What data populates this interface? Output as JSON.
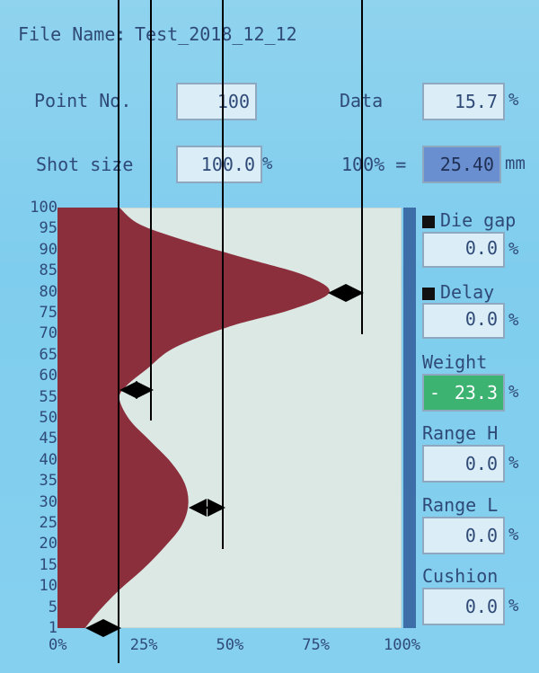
{
  "file_name_label": "File Name:",
  "file_name_value": "Test_2018_12_12",
  "point_no_label": "Point No.",
  "point_no_value": "100",
  "data_label": "Data",
  "data_value": "15.7",
  "data_unit": "%",
  "shot_size_label": "Shot size",
  "shot_size_value": "100.0",
  "shot_size_unit": "%",
  "hundred_pct_label": "100% =",
  "hundred_pct_value": "25.40",
  "hundred_pct_unit": "mm",
  "right_panel": {
    "die_gap": {
      "label": "Die gap",
      "value": "0.0",
      "unit": "%"
    },
    "delay": {
      "label": "Delay",
      "value": "0.0",
      "unit": "%"
    },
    "weight": {
      "label": "Weight",
      "sign": "-",
      "value": "23.3",
      "unit": "%"
    },
    "range_h": {
      "label": "Range H",
      "value": "0.0",
      "unit": "%"
    },
    "range_l": {
      "label": "Range L",
      "value": "0.0",
      "unit": "%"
    },
    "cushion": {
      "label": "Cushion",
      "value": "0.0",
      "unit": "%"
    }
  },
  "chart_data": {
    "type": "area",
    "y_ticks": [
      "100",
      "95",
      "90",
      "85",
      "80",
      "75",
      "70",
      "65",
      "60",
      "55",
      "50",
      "45",
      "40",
      "35",
      "30",
      "25",
      "20",
      "15",
      "10",
      "5",
      "1"
    ],
    "x_ticks": [
      "0%",
      "25%",
      "50%",
      "75%",
      "100%"
    ],
    "xlim": [
      0,
      100
    ],
    "ylim": [
      1,
      100
    ],
    "profile": [
      {
        "point": 1,
        "value": 8
      },
      {
        "point": 5,
        "value": 12
      },
      {
        "point": 10,
        "value": 18
      },
      {
        "point": 15,
        "value": 25
      },
      {
        "point": 20,
        "value": 31
      },
      {
        "point": 25,
        "value": 36
      },
      {
        "point": 30,
        "value": 38
      },
      {
        "point": 35,
        "value": 37
      },
      {
        "point": 40,
        "value": 33
      },
      {
        "point": 45,
        "value": 27
      },
      {
        "point": 50,
        "value": 21
      },
      {
        "point": 55,
        "value": 18
      },
      {
        "point": 58,
        "value": 20
      },
      {
        "point": 62,
        "value": 26
      },
      {
        "point": 67,
        "value": 34
      },
      {
        "point": 72,
        "value": 50
      },
      {
        "point": 76,
        "value": 68
      },
      {
        "point": 80,
        "value": 79
      },
      {
        "point": 84,
        "value": 72
      },
      {
        "point": 88,
        "value": 55
      },
      {
        "point": 92,
        "value": 38
      },
      {
        "point": 96,
        "value": 24
      },
      {
        "point": 100,
        "value": 18
      }
    ],
    "colors": {
      "fill": "#8b2f3c",
      "plot_bg": "#dce8e4",
      "scrollbar": "#3d6ea8"
    }
  }
}
